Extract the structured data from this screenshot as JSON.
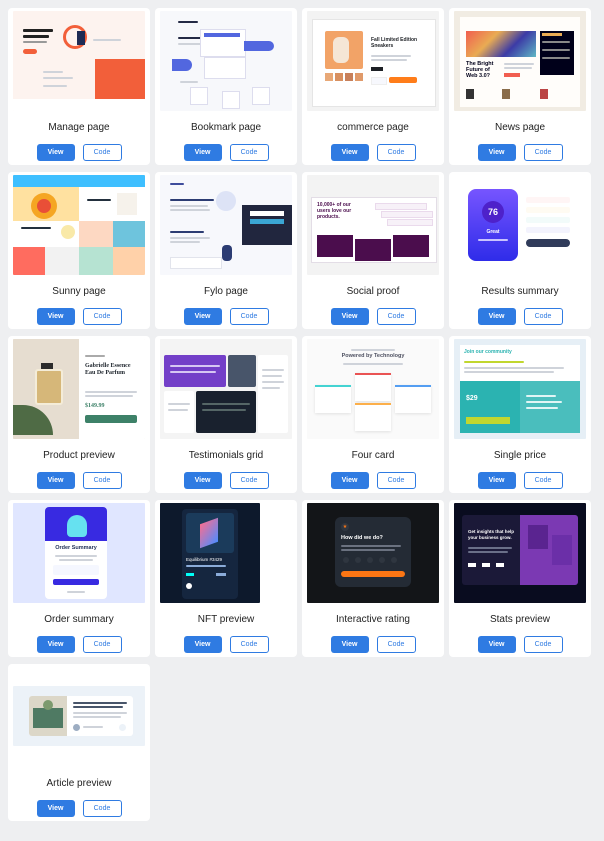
{
  "buttons": {
    "view": "View",
    "code": "Code"
  },
  "cards": [
    {
      "title": "Manage page"
    },
    {
      "title": "Bookmark page"
    },
    {
      "title": "commerce page"
    },
    {
      "title": "News page"
    },
    {
      "title": "Sunny page"
    },
    {
      "title": "Fylo page"
    },
    {
      "title": "Social proof"
    },
    {
      "title": "Results summary"
    },
    {
      "title": "Product preview"
    },
    {
      "title": "Testimonials grid"
    },
    {
      "title": "Four card"
    },
    {
      "title": "Single price"
    },
    {
      "title": "Order summary"
    },
    {
      "title": "NFT preview"
    },
    {
      "title": "Interactive rating"
    },
    {
      "title": "Stats preview"
    },
    {
      "title": "Article preview"
    }
  ],
  "thumbnails": {
    "commerce": {
      "heading": "Fall Limited Edition Sneakers"
    },
    "news": {
      "heading": "The Bright Future of Web 3.0?"
    },
    "social": {
      "heading": "10,000+ of our users love our products."
    },
    "results": {
      "score": "76",
      "label": "Great"
    },
    "product": {
      "name": "Gabrielle Essence Eau De Parfum",
      "price": "$149.99"
    },
    "four": {
      "heading": "Powered by Technology"
    },
    "single": {
      "heading": "Join our community",
      "price": "$29"
    },
    "order": {
      "heading": "Order Summary"
    },
    "nft": {
      "name": "Equilibrium #3429"
    },
    "rating": {
      "heading": "How did we do?"
    },
    "stats": {
      "heading": "Get insights that help your business grow."
    }
  }
}
